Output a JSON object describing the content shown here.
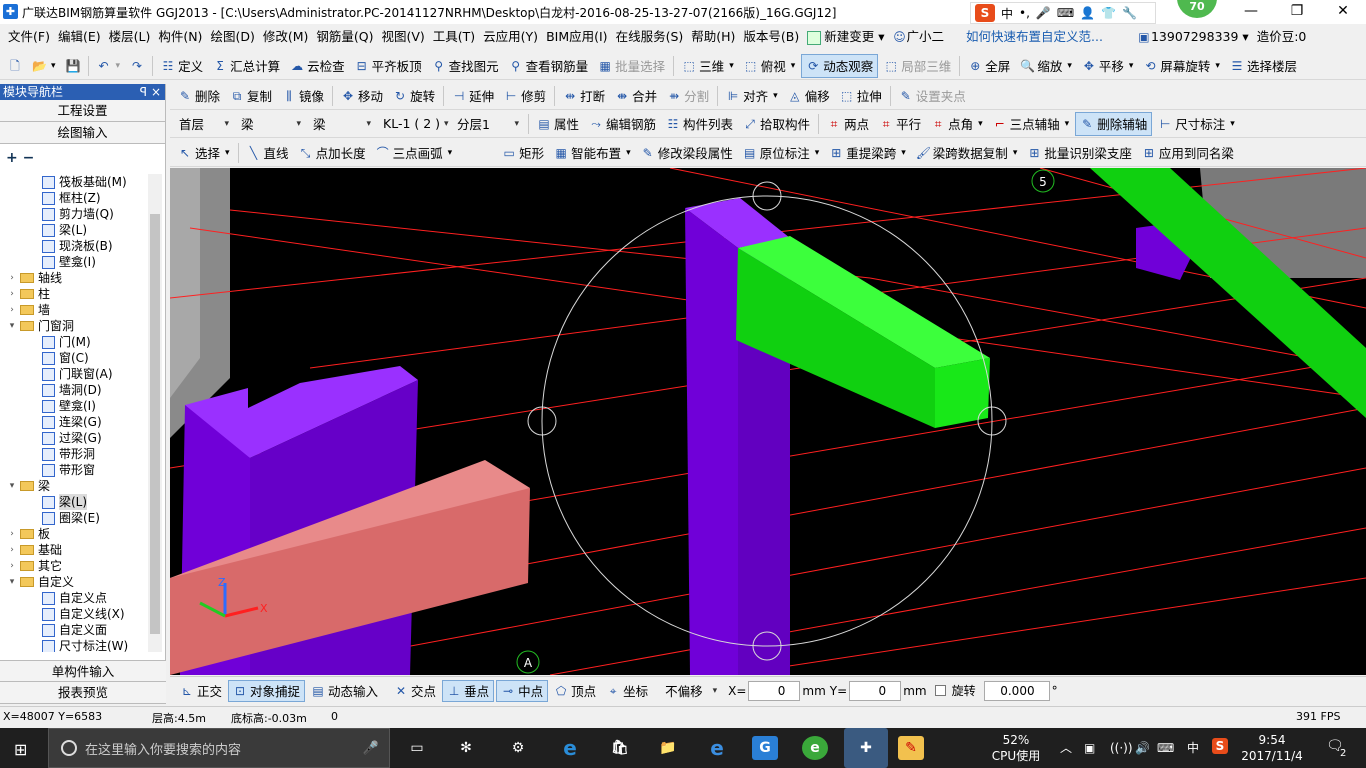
{
  "window": {
    "title": "广联达BIM钢筋算量软件 GGJ2013 - [C:\\Users\\Administrator.PC-20141127NRHM\\Desktop\\白龙村-2016-08-25-13-27-07(2166版)_16G.GGJ12]",
    "ime_label": "中",
    "badge": "70"
  },
  "menu": {
    "items": [
      "文件(F)",
      "编辑(E)",
      "楼层(L)",
      "构件(N)",
      "绘图(D)",
      "修改(M)",
      "钢筋量(Q)",
      "视图(V)",
      "工具(T)",
      "云应用(Y)",
      "BIM应用(I)",
      "在线服务(S)",
      "帮助(H)",
      "版本号(B)"
    ],
    "new_change": "新建变更",
    "assistant": "广小二",
    "tip": "如何快速布置自定义范...",
    "phone": "13907298339",
    "beans": "造价豆:0"
  },
  "toolbar1": {
    "items": [
      "定义",
      "汇总计算",
      "云检查",
      "平齐板顶",
      "查找图元",
      "查看钢筋量",
      "批量选择"
    ],
    "view": [
      "三维",
      "俯视",
      "动态观察",
      "局部三维",
      "全屏",
      "缩放",
      "平移",
      "屏幕旋转",
      "选择楼层"
    ]
  },
  "toolbar2": {
    "items": [
      "删除",
      "复制",
      "镜像",
      "移动",
      "旋转",
      "延伸",
      "修剪",
      "打断",
      "合并",
      "分割",
      "对齐",
      "偏移",
      "拉伸",
      "设置夹点"
    ]
  },
  "toolbar3": {
    "floor": "首层",
    "category": "梁",
    "type": "梁",
    "component": "KL-1 ( 2 )",
    "layer": "分层1",
    "items": [
      "属性",
      "编辑钢筋",
      "构件列表",
      "拾取构件",
      "两点",
      "平行",
      "点角",
      "三点辅轴",
      "删除辅轴",
      "尺寸标注"
    ]
  },
  "toolbar4": {
    "items": [
      "选择",
      "直线",
      "点加长度",
      "三点画弧",
      "矩形",
      "智能布置",
      "修改梁段属性",
      "原位标注",
      "重提梁跨",
      "梁跨数据复制",
      "批量识别梁支座",
      "应用到同名梁"
    ]
  },
  "nav": {
    "title": "模块导航栏",
    "pin": "ꟼ",
    "close": "×",
    "btn_project": "工程设置",
    "btn_draw": "绘图输入",
    "btn_single": "单构件输入",
    "btn_report": "报表预览",
    "tools_label": "+ −",
    "tree": [
      {
        "level": 2,
        "label": "筏板基础(M)",
        "icon": "raft-icon"
      },
      {
        "level": 2,
        "label": "框柱(Z)",
        "icon": "frame-column-icon"
      },
      {
        "level": 2,
        "label": "剪力墙(Q)",
        "icon": "shear-wall-icon"
      },
      {
        "level": 2,
        "label": "梁(L)",
        "icon": "beam-icon"
      },
      {
        "level": 2,
        "label": "现浇板(B)",
        "icon": "slab-icon"
      },
      {
        "level": 2,
        "label": "壁龛(I)",
        "icon": "niche-icon"
      },
      {
        "level": 1,
        "label": "轴线",
        "toggle": "+"
      },
      {
        "level": 1,
        "label": "柱",
        "toggle": "+"
      },
      {
        "level": 1,
        "label": "墙",
        "toggle": "+"
      },
      {
        "level": 1,
        "label": "门窗洞",
        "toggle": "-"
      },
      {
        "level": 2,
        "label": "门(M)",
        "icon": "door-icon"
      },
      {
        "level": 2,
        "label": "窗(C)",
        "icon": "window-icon"
      },
      {
        "level": 2,
        "label": "门联窗(A)",
        "icon": "door-window-icon"
      },
      {
        "level": 2,
        "label": "墙洞(D)",
        "icon": "wall-hole-icon"
      },
      {
        "level": 2,
        "label": "壁龛(I)",
        "icon": "niche-icon"
      },
      {
        "level": 2,
        "label": "连梁(G)",
        "icon": "link-beam-icon"
      },
      {
        "level": 2,
        "label": "过梁(G)",
        "icon": "lintel-icon"
      },
      {
        "level": 2,
        "label": "带形洞",
        "icon": "strip-hole-icon"
      },
      {
        "level": 2,
        "label": "带形窗",
        "icon": "strip-window-icon"
      },
      {
        "level": 1,
        "label": "梁",
        "toggle": "-"
      },
      {
        "level": 2,
        "label": "梁(L)",
        "icon": "beam-icon",
        "selected": true
      },
      {
        "level": 2,
        "label": "圈梁(E)",
        "icon": "ring-beam-icon"
      },
      {
        "level": 1,
        "label": "板",
        "toggle": "+"
      },
      {
        "level": 1,
        "label": "基础",
        "toggle": "+"
      },
      {
        "level": 1,
        "label": "其它",
        "toggle": "+"
      },
      {
        "level": 1,
        "label": "自定义",
        "toggle": "-"
      },
      {
        "level": 2,
        "label": "自定义点",
        "icon": "custom-point-icon"
      },
      {
        "level": 2,
        "label": "自定义线(X)",
        "icon": "custom-line-icon"
      },
      {
        "level": 2,
        "label": "自定义面",
        "icon": "custom-face-icon"
      },
      {
        "level": 2,
        "label": "尺寸标注(W)",
        "icon": "dimension-icon"
      }
    ]
  },
  "viewport": {
    "axis_labels": [
      "5",
      "A"
    ],
    "colors": {
      "column": "#7a00e6",
      "beam_green": "#10e010",
      "beam_pink": "#e07070",
      "grid": "#ff2020"
    }
  },
  "snapbar": {
    "items": [
      "正交",
      "对象捕捉",
      "动态输入",
      "交点",
      "垂点",
      "中点",
      "顶点",
      "坐标"
    ],
    "offset": "不偏移",
    "x_label": "X=",
    "x_value": "0",
    "x_unit": "mm",
    "y_label": "Y=",
    "y_value": "0",
    "y_unit": "mm",
    "rotate_label": "旋转",
    "rotate_value": "0.000",
    "rotate_unit": "°"
  },
  "status": {
    "coords": "X=48007 Y=6583",
    "floor_height": "层高:4.5m",
    "bottom_height": "底标高:-0.03m",
    "value": "0",
    "fps": "391 FPS"
  },
  "taskbar": {
    "search_placeholder": "在这里输入你要搜索的内容",
    "cpu_percent": "52%",
    "cpu_label": "CPU使用",
    "ime": "中",
    "time": "9:54",
    "date": "2017/11/4",
    "notifications": "2"
  }
}
